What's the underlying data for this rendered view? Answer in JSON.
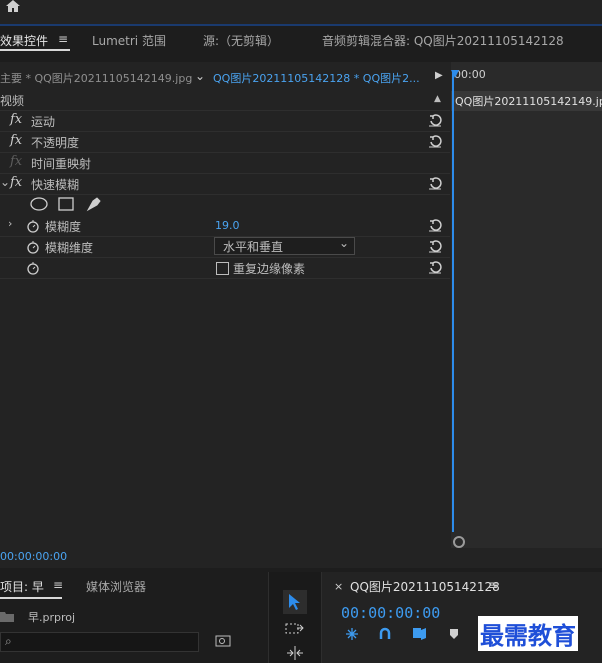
{
  "tabs": {
    "effect_controls": "效果控件",
    "lumetri": "Lumetri 范围",
    "source": "源:（无剪辑）",
    "audio_mixer": "音频剪辑混合器: QQ图片20211105142128"
  },
  "header": {
    "master_clip": "主要 * QQ图片20211105142149.jpg",
    "sequence_clip": "QQ图片20211105142128 * QQ图片2...",
    "timecode_start": "00:00",
    "clip_bar_label": "QQ图片20211105142149.jpg"
  },
  "effects": {
    "video_header": "视频",
    "motion": "运动",
    "opacity": "不透明度",
    "time_remap": "时间重映射",
    "fast_blur": "快速模糊",
    "blurriness_label": "模糊度",
    "blurriness_value": "19.0",
    "blur_dimensions_label": "模糊维度",
    "blur_dimensions_value": "水平和垂直",
    "repeat_edge_label": "重复边缘像素"
  },
  "footer_timecode": "00:00:00:00",
  "bottom": {
    "project_tab": "项目: 早",
    "media_browser_tab": "媒体浏览器",
    "project_file": "早.prproj",
    "sequence_tab": "QQ图片20211105142128",
    "sequence_timecode": "00:00:00:00",
    "watermark": "最需教育"
  }
}
